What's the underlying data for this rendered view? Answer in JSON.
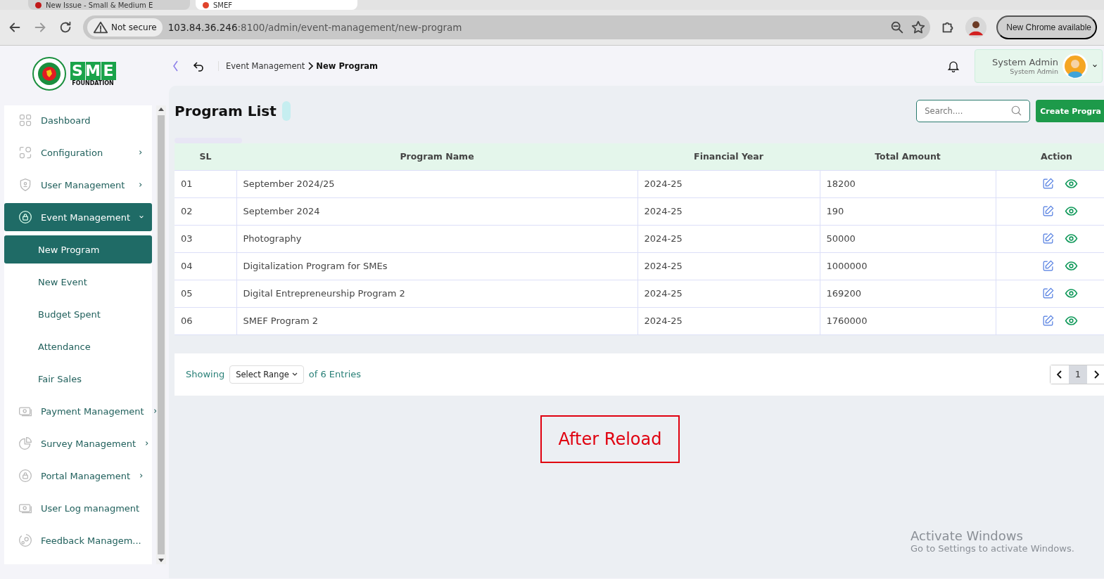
{
  "browser": {
    "tabs": [
      {
        "title": "New Issue - Small & Medium E",
        "selected": false
      },
      {
        "title": "SMEF",
        "selected": true
      }
    ],
    "security_label": "Not secure",
    "url_host": "103.84.36.246",
    "url_rest": ":8100/admin/event-management/new-program",
    "update_button": "New Chrome available"
  },
  "logo": {
    "letters": [
      "S",
      "M",
      "E"
    ],
    "subtitle": "FOUNDATION"
  },
  "header": {
    "breadcrumb": [
      "Event Management",
      "New Program"
    ],
    "user_name": "System Admin",
    "user_role": "System Admin"
  },
  "sidebar": {
    "items": [
      {
        "label": "Dashboard",
        "selected": false
      },
      {
        "label": "Configuration",
        "expanded": false,
        "selected": false
      },
      {
        "label": "User Management",
        "expanded": false,
        "selected": false
      },
      {
        "label": "Event Management",
        "expanded": true,
        "selected": true,
        "children": [
          {
            "label": "New Program",
            "selected": true
          },
          {
            "label": "New Event",
            "selected": false
          },
          {
            "label": "Budget Spent",
            "selected": false
          },
          {
            "label": "Attendance",
            "selected": false
          },
          {
            "label": "Fair Sales",
            "selected": false
          }
        ]
      },
      {
        "label": "Payment Management",
        "expanded": false,
        "selected": false
      },
      {
        "label": "Survey Management",
        "expanded": false,
        "selected": false
      },
      {
        "label": "Portal Management",
        "expanded": false,
        "selected": false
      },
      {
        "label": "User Log managment",
        "selected": false
      },
      {
        "label": "Feedback Managem...",
        "selected": false
      }
    ]
  },
  "page": {
    "title": "Program List",
    "search_placeholder": "Search....",
    "create_button": "Create Progra"
  },
  "table": {
    "columns": [
      "SL",
      "Program Name",
      "Financial Year",
      "Total Amount",
      "Action"
    ],
    "rows": [
      {
        "cells": [
          "01",
          "September 2024/25",
          "2024-25",
          "18200"
        ]
      },
      {
        "cells": [
          "02",
          "September 2024",
          "2024-25",
          "190"
        ]
      },
      {
        "cells": [
          "03",
          "Photography",
          "2024-25",
          "50000"
        ]
      },
      {
        "cells": [
          "04",
          "Digitalization Program for SMEs",
          "2024-25",
          "1000000"
        ]
      },
      {
        "cells": [
          "05",
          "Digital Entrepreneurship Program 2",
          "2024-25",
          "169200"
        ]
      },
      {
        "cells": [
          "06",
          "SMEF Program 2",
          "2024-25",
          "1760000"
        ]
      }
    ]
  },
  "pagination": {
    "showing": "Showing",
    "range_select": "Select Range",
    "entries": "of 6 Entries",
    "pages": [
      {
        "label": "1",
        "selected": true
      }
    ]
  },
  "annotation": {
    "text": "After Reload"
  },
  "os_notice": {
    "title": "Activate Windows",
    "message": "Go to Settings to activate Windows."
  }
}
